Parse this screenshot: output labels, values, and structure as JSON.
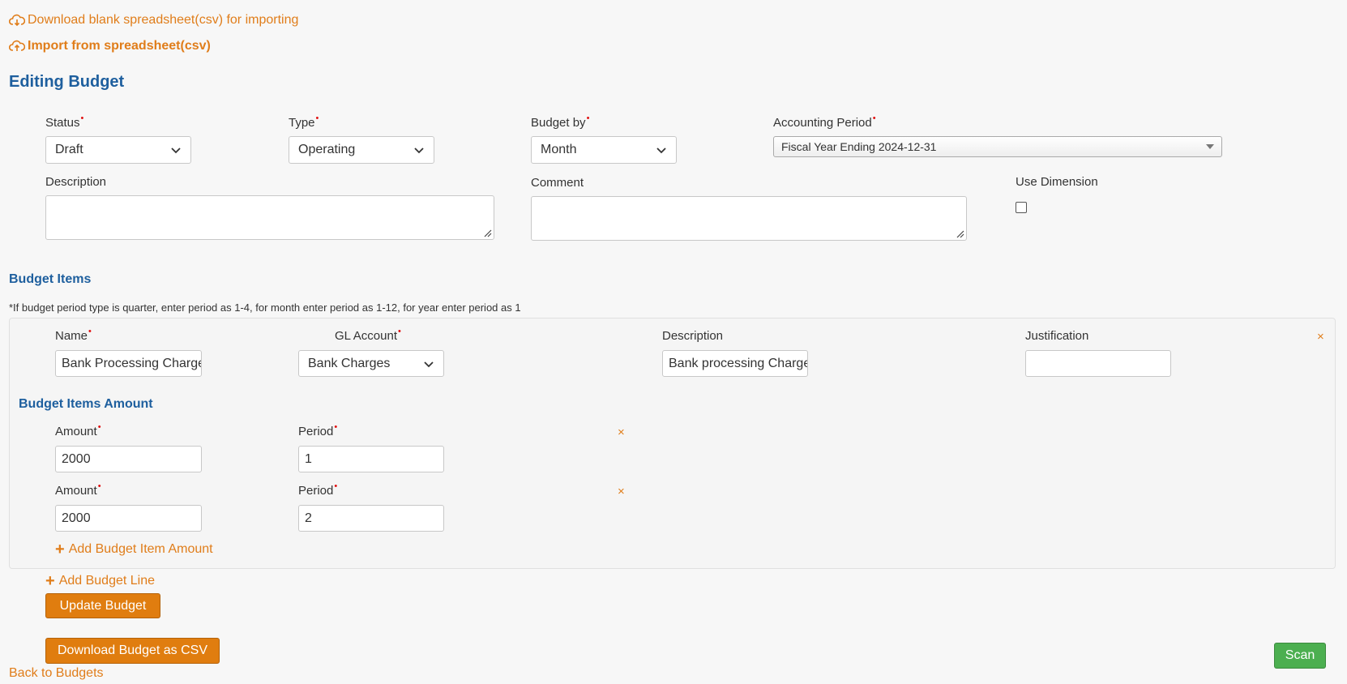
{
  "top_links": {
    "download_blank": "Download blank spreadsheet(csv) for importing",
    "import_csv": "Import from spreadsheet(csv)"
  },
  "page_title": "Editing Budget",
  "form": {
    "status": {
      "label": "Status",
      "value": "Draft"
    },
    "type": {
      "label": "Type",
      "value": "Operating"
    },
    "budget_by": {
      "label": "Budget by",
      "value": "Month"
    },
    "accounting_period": {
      "label": "Accounting Period",
      "value": "Fiscal Year Ending 2024-12-31"
    },
    "description": {
      "label": "Description",
      "value": ""
    },
    "comment": {
      "label": "Comment",
      "value": ""
    },
    "use_dimension": {
      "label": "Use Dimension",
      "checked": false
    }
  },
  "budget_items": {
    "heading": "Budget Items",
    "note": "*If budget period type is quarter, enter period as 1-4, for month enter period as 1-12, for year enter period as 1",
    "item": {
      "name_label": "Name",
      "name_value": "Bank Processing Charges",
      "gl_label": "GL Account",
      "gl_value": "Bank Charges",
      "desc_label": "Description",
      "desc_value": "Bank processing Charges",
      "justification_label": "Justification",
      "justification_value": "",
      "remove": "×"
    },
    "amounts_heading": "Budget Items Amount",
    "amounts": [
      {
        "amount_label": "Amount",
        "amount_value": "2000",
        "period_label": "Period",
        "period_value": "1",
        "remove": "×"
      },
      {
        "amount_label": "Amount",
        "amount_value": "2000",
        "period_label": "Period",
        "period_value": "2",
        "remove": "×"
      }
    ],
    "add_amount": "Add Budget Item Amount"
  },
  "add_line": "Add Budget Line",
  "buttons": {
    "update": "Update Budget",
    "download_csv": "Download Budget as CSV",
    "scan": "Scan"
  },
  "back_link": "Back to Budgets",
  "colors": {
    "accent": "#e07d1a",
    "heading": "#1e5f9e",
    "required": "#e01010",
    "scan": "#4caf50"
  }
}
